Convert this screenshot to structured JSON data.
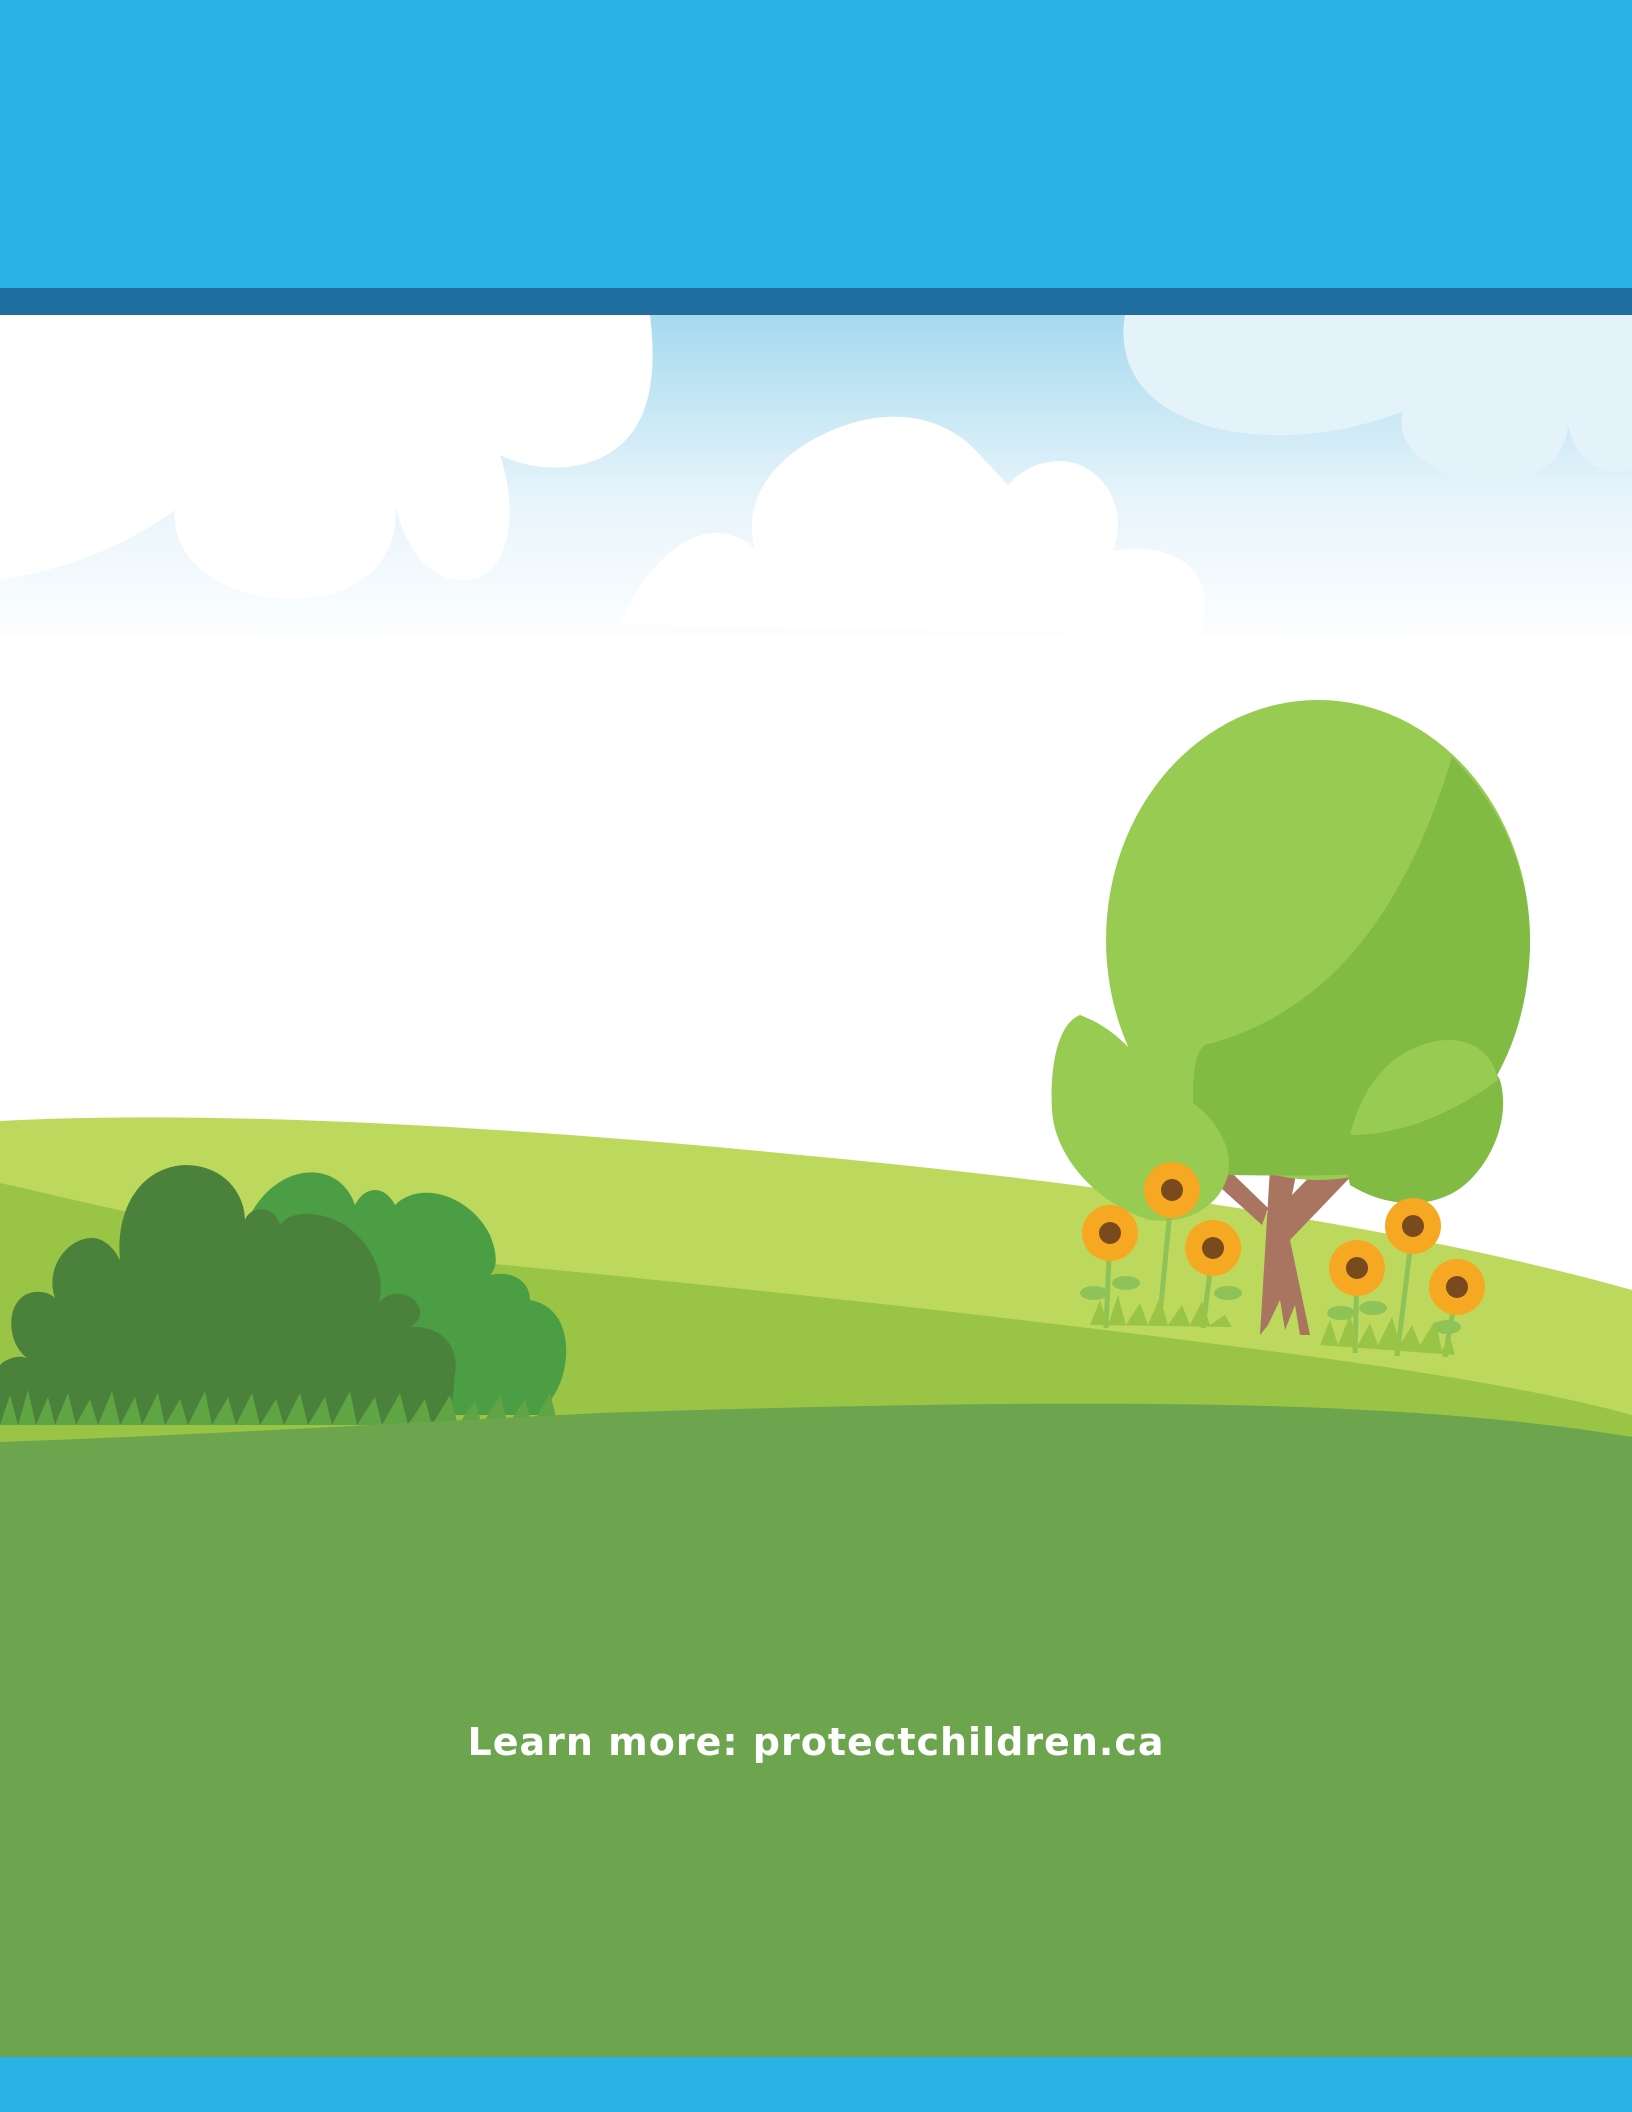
{
  "footer": {
    "learn_more": "Learn more: protectchildren.ca"
  },
  "colors": {
    "banner": "#2ab1e6",
    "stripe": "#206d9f",
    "grass_dark": "#6ca54e",
    "grass_light": "#bdd95d",
    "grass_mid": "#9ac446",
    "tree": "#98cb52",
    "trunk": "#a97560",
    "flower": "#f7a823"
  }
}
